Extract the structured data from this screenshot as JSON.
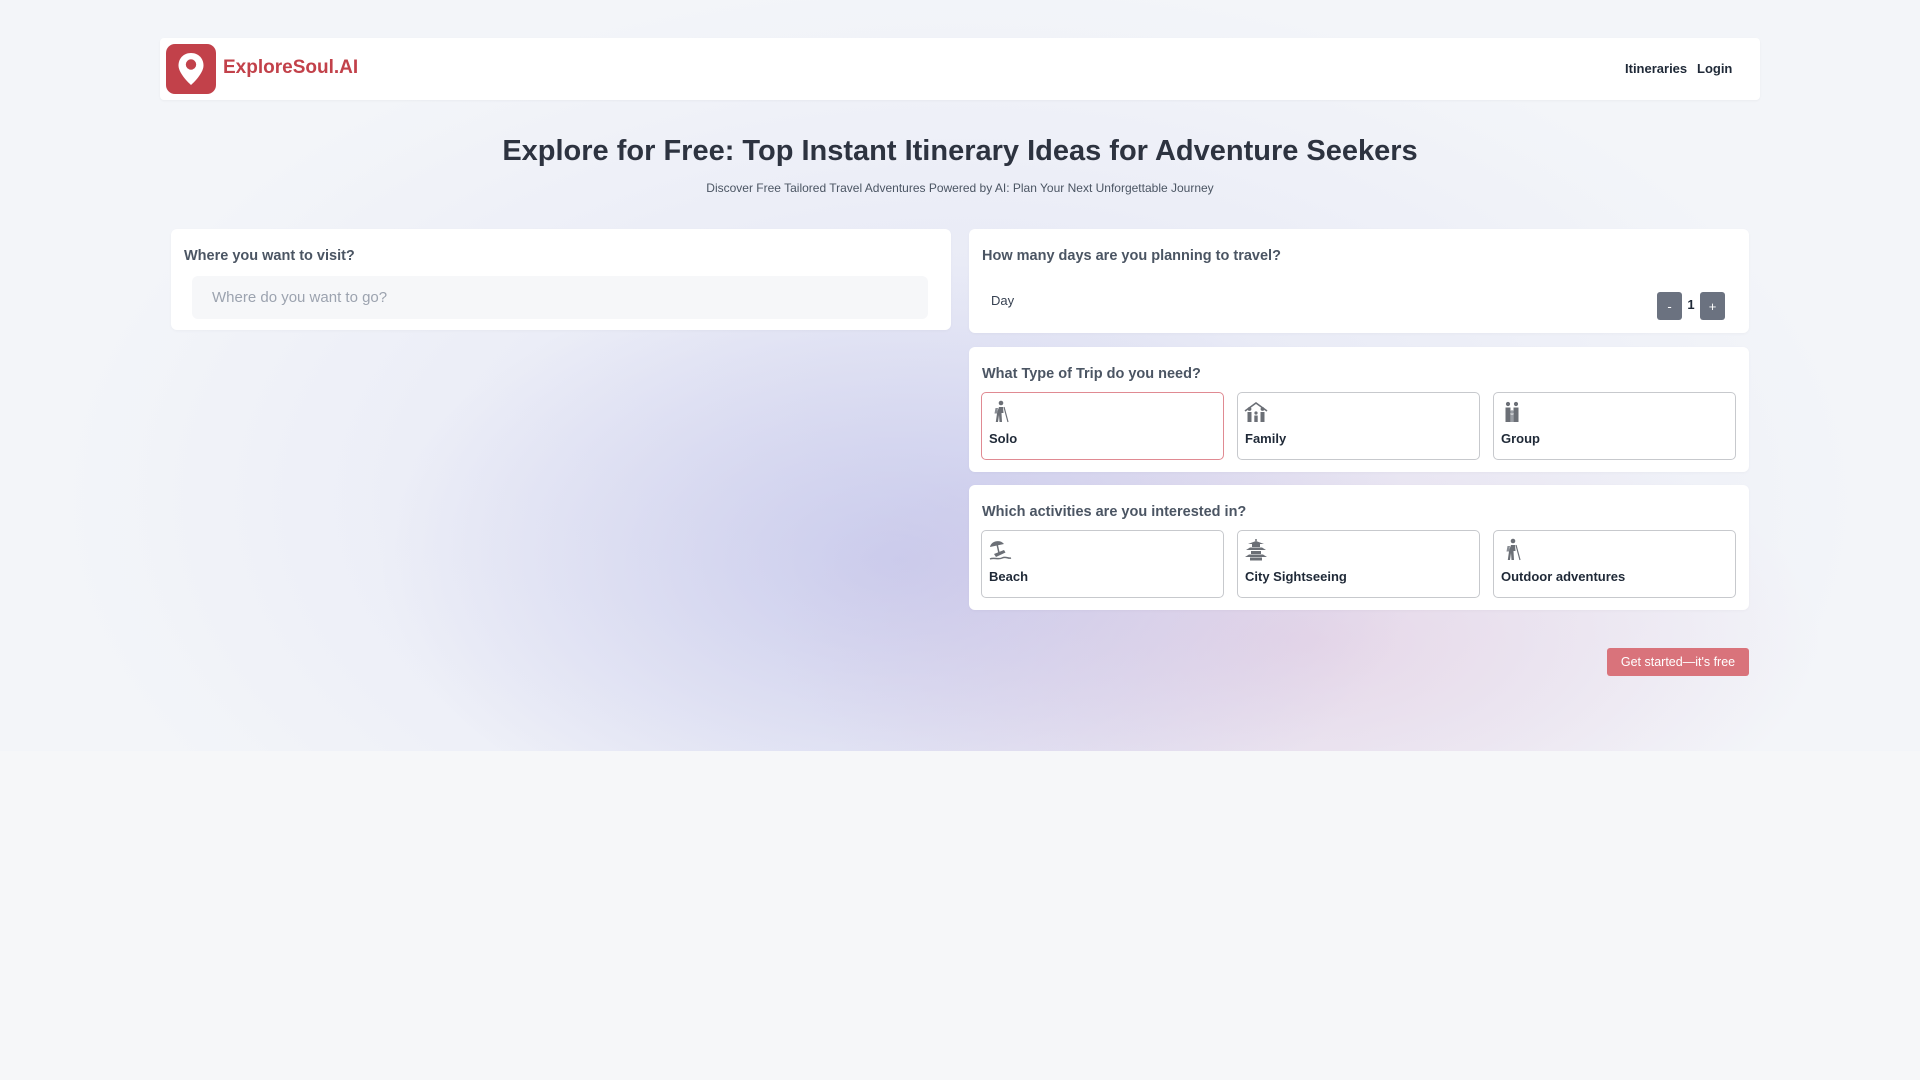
{
  "navbar": {
    "brand": "ExploreSoul.AI",
    "logo_icon": "map-pin-icon",
    "links": [
      "Itineraries",
      "Login"
    ]
  },
  "hero": {
    "title": "Explore for Free: Top Instant Itinerary Ideas for Adventure Seekers",
    "subtitle": "Discover Free Tailored Travel Adventures Powered by AI: Plan Your Next Unforgettable Journey"
  },
  "destination": {
    "label": "Where you want to visit?",
    "placeholder": "Where do you want to go?",
    "value": ""
  },
  "days": {
    "label": "How many days are you planning to travel?",
    "unit_label": "Day",
    "decrement": "-",
    "value": "1",
    "increment": "+"
  },
  "trip_type": {
    "label": "What Type of Trip do you need?",
    "selected": "Solo",
    "options": [
      {
        "label": "Solo",
        "icon": "hiker-icon"
      },
      {
        "label": "Family",
        "icon": "family-icon"
      },
      {
        "label": "Group",
        "icon": "group-icon"
      }
    ]
  },
  "activities": {
    "label": "Which activities are you interested in?",
    "options": [
      {
        "label": "Beach",
        "icon": "beach-umbrella-icon"
      },
      {
        "label": "City Sightseeing",
        "icon": "pagoda-icon"
      },
      {
        "label": "Outdoor adventures",
        "icon": "hiker-icon"
      }
    ]
  },
  "cta": {
    "label": "Get started—it's free"
  },
  "colors": {
    "brand": "#c2414a",
    "cta": "#d9737b",
    "selected_border": "#e08a92",
    "stepper": "#6b7280"
  }
}
